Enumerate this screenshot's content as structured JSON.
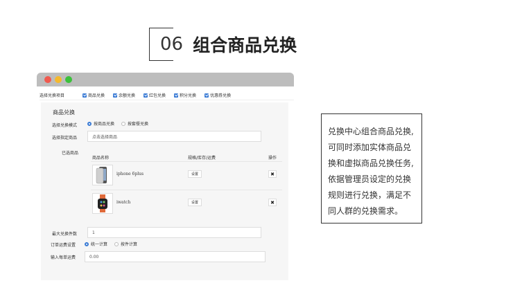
{
  "heading": {
    "number": "06",
    "title": "组合商品兑换"
  },
  "window": {
    "tabs_title": "选择兑换项目",
    "tabs": [
      {
        "label": "商品兑换"
      },
      {
        "label": "余额兑换"
      },
      {
        "label": "红包兑换"
      },
      {
        "label": "积分兑换"
      },
      {
        "label": "优惠券兑换"
      }
    ],
    "section_title": "商品兑换",
    "mode_label": "选择兑换模式",
    "mode_options": [
      {
        "label": "按商品兑换",
        "selected": true
      },
      {
        "label": "按套餐兑换",
        "selected": false
      }
    ],
    "select_goods_label": "选择指定商品",
    "select_goods_placeholder": "点击选择商品",
    "selected_label": "已选商品",
    "table_headers": {
      "name": "商品名称",
      "spec": "规格/库存/运费",
      "action": "操作"
    },
    "products": [
      {
        "name": "iphone 6plus",
        "set_label": "设置",
        "delete_icon": "✖"
      },
      {
        "name": "iwatch",
        "set_label": "设置",
        "delete_icon": "✖"
      }
    ],
    "max_count_label": "最大兑换件数",
    "max_count_value": "1",
    "freight_label": "订单运费设置",
    "freight_options": [
      {
        "label": "统一计算",
        "selected": true
      },
      {
        "label": "按件计算",
        "selected": false
      }
    ],
    "per_order_label": "输入每单运费",
    "per_order_value": "0.00"
  },
  "description": {
    "lines": [
      "兑换中心组合商品兑换,",
      "可同时添加实体商品兑",
      "换和虚拟商品兑换任务,",
      "依据管理员设定的兑换",
      "规则进行兑换，满足不",
      "同人群的兑换需求。"
    ]
  },
  "colors": {
    "accent": "#3a7bd5",
    "titlebar": "#bdbdbd",
    "panel": "#f6f6f6"
  }
}
